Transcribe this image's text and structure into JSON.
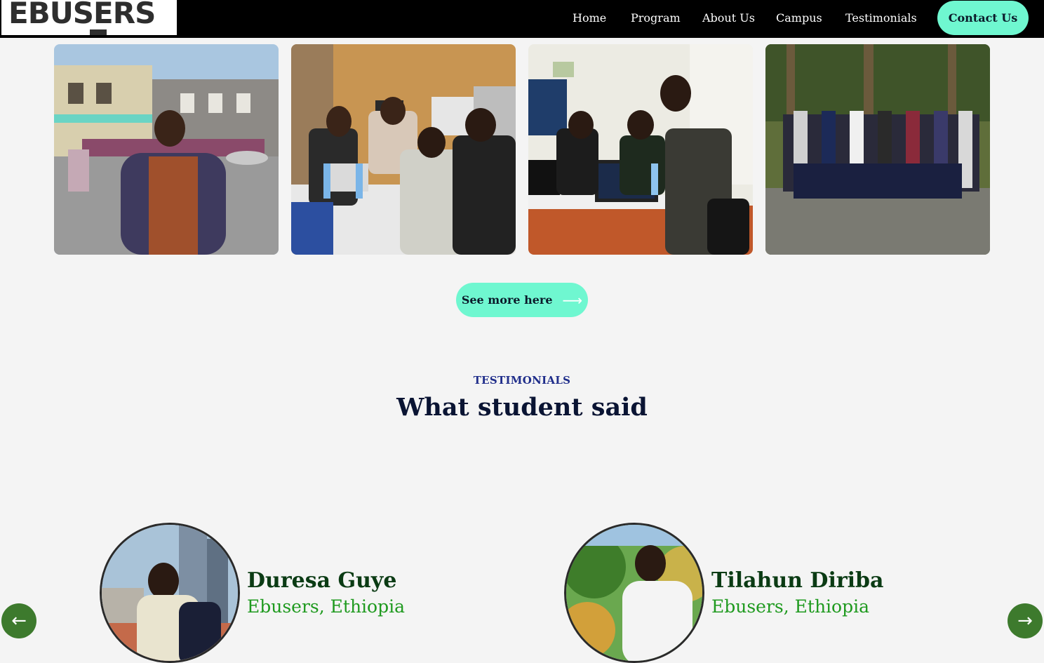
{
  "nav": {
    "logo": "EBUSERS",
    "links": [
      "Home",
      "Program",
      "About Us",
      "Campus",
      "Testimonials"
    ],
    "contact_label": "Contact Us"
  },
  "gallery": {
    "photos": [
      "campus-building-student",
      "students-at-computers",
      "students-coding",
      "group-photo"
    ],
    "see_more_label": "See more here"
  },
  "testimonials": {
    "eyebrow": "TESTIMONIALS",
    "heading": "What student said",
    "people": [
      {
        "name": "Duresa Guye",
        "org": "Ebusers, Ethiopia"
      },
      {
        "name": "Tilahun Diriba",
        "org": "Ebusers, Ethiopia"
      }
    ]
  },
  "colors": {
    "accent": "#6ff7d0",
    "nav_bg": "#000000",
    "arrow_bg": "#3d7a2d",
    "name": "#0b3b14",
    "org": "#1f9a1f"
  }
}
